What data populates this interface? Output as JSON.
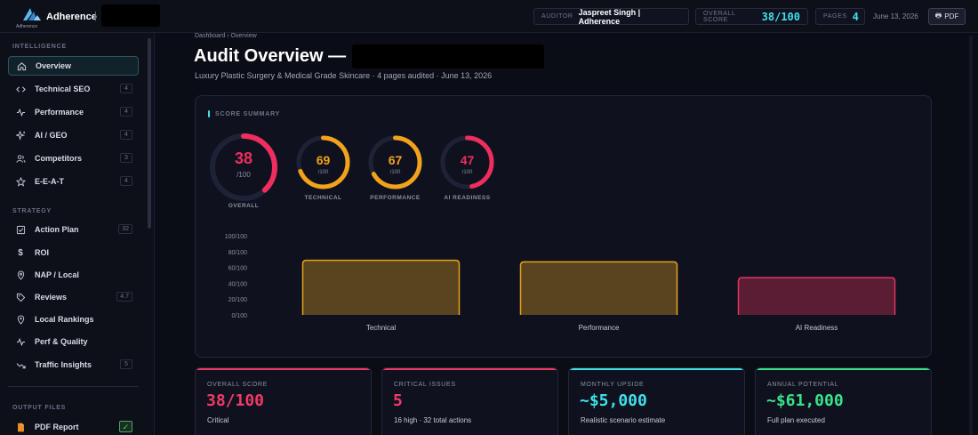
{
  "topbar": {
    "brand": "Adherence",
    "brand_sep": "|",
    "logo_text": "Adherence",
    "auditor_key": "AUDITOR",
    "auditor_val": "Jaspreet Singh | Adherence",
    "score_key": "OVERALL SCORE",
    "score_val": "38/100",
    "pages_key": "PAGES",
    "pages_val": "4",
    "date": "June 13, 2026",
    "pdf_label": "PDF",
    "pdf_icon": "printer-icon"
  },
  "sidebar": {
    "intelligence_label": "INTELLIGENCE",
    "strategy_label": "STRATEGY",
    "output_label": "OUTPUT FILES",
    "intelligence_items": [
      {
        "label": "Overview",
        "icon": "home-icon",
        "badge": ""
      },
      {
        "label": "Technical SEO",
        "icon": "code-icon",
        "badge": "4"
      },
      {
        "label": "Performance",
        "icon": "pulse-icon",
        "badge": "4"
      },
      {
        "label": "AI / GEO",
        "icon": "sparkle-icon",
        "badge": "4"
      },
      {
        "label": "Competitors",
        "icon": "users-icon",
        "badge": "3"
      },
      {
        "label": "E-E-A-T",
        "icon": "star-icon",
        "badge": "4"
      }
    ],
    "strategy_items": [
      {
        "label": "Action Plan",
        "icon": "checklist-icon",
        "badge": "32"
      },
      {
        "label": "ROI",
        "icon": "dollar-icon",
        "badge": ""
      },
      {
        "label": "NAP / Local",
        "icon": "pin-icon",
        "badge": ""
      },
      {
        "label": "Reviews",
        "icon": "tag-icon",
        "badge": "4.7"
      },
      {
        "label": "Local Rankings",
        "icon": "location-icon",
        "badge": ""
      },
      {
        "label": "Perf & Quality",
        "icon": "pulse-icon",
        "badge": ""
      },
      {
        "label": "Traffic Insights",
        "icon": "trend-icon",
        "badge": "5"
      }
    ],
    "output_items": [
      {
        "label": "PDF Report",
        "icon": "document-icon",
        "badge": "✓"
      }
    ]
  },
  "main": {
    "breadcrumb": "Dashboard › Overview",
    "title": "Audit Overview —",
    "subtitle": "Luxury Plastic Surgery & Medical Grade Skincare  ·  4 pages audited  ·  June 13, 2026",
    "panel_label": "SCORE SUMMARY",
    "rings": [
      {
        "label": "OVERALL",
        "value": "38",
        "sub": "/100",
        "score": 38,
        "color": "#ef2d5e"
      },
      {
        "label": "TECHNICAL",
        "value": "69",
        "sub": "/100",
        "score": 69,
        "color": "#f2a21b"
      },
      {
        "label": "PERFORMANCE",
        "value": "67",
        "sub": "/100",
        "score": 67,
        "color": "#f2a21b"
      },
      {
        "label": "AI READINESS",
        "value": "47",
        "sub": "/100",
        "score": 47,
        "color": "#ef2d5e"
      }
    ]
  },
  "chart_data": {
    "type": "bar",
    "categories": [
      "Technical",
      "Performance",
      "AI Readiness"
    ],
    "values": [
      69,
      67,
      47
    ],
    "y_ticks": [
      "0/100",
      "20/100",
      "40/100",
      "60/100",
      "80/100",
      "100/100"
    ],
    "ylim": [
      0,
      100
    ],
    "grid": false,
    "colors": {
      "Technical": {
        "fill": "#5a4420",
        "stroke": "#e6a11c"
      },
      "Performance": {
        "fill": "#5a4420",
        "stroke": "#e6a11c"
      },
      "AI Readiness": {
        "fill": "#5a1d33",
        "stroke": "#e6335f"
      }
    }
  },
  "cards": [
    {
      "key": "OVERALL SCORE",
      "value": "38/100",
      "sub": "Critical",
      "color": "#ef3a66"
    },
    {
      "key": "CRITICAL ISSUES",
      "value": "5",
      "sub": "16 high · 32 total actions",
      "color": "#ef3a66"
    },
    {
      "key": "MONTHLY UPSIDE",
      "value": "~$5,000",
      "sub": "Realistic scenario estimate",
      "color": "#3fe0ea"
    },
    {
      "key": "ANNUAL POTENTIAL",
      "value": "~$61,000",
      "sub": "Full plan executed",
      "color": "#39e28a"
    }
  ]
}
